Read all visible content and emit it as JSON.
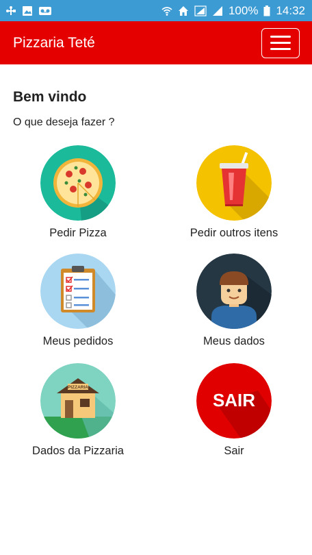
{
  "statusbar": {
    "battery": "100%",
    "time": "14:32",
    "icons": [
      "usb-icon",
      "image-icon",
      "voicemail-icon",
      "wifi-icon",
      "home-icon",
      "signal-icon",
      "signal-icon",
      "battery-icon"
    ]
  },
  "appbar": {
    "title": "Pizzaria Teté",
    "menu_icon": "hamburger-menu-icon"
  },
  "main": {
    "welcome": "Bem vindo",
    "question": "O que deseja fazer ?",
    "tiles": [
      {
        "label": "Pedir Pizza",
        "icon": "pizza-icon",
        "color": "#1aba9a"
      },
      {
        "label": "Pedir outros itens",
        "icon": "drink-cup-icon",
        "color": "#f5c200"
      },
      {
        "label": "Meus pedidos",
        "icon": "clipboard-checklist-icon",
        "color": "#a9d7f2"
      },
      {
        "label": "Meus dados",
        "icon": "user-avatar-icon",
        "color": "#263744"
      },
      {
        "label": "Dados da Pizzaria",
        "icon": "pizzaria-house-icon",
        "color": "#7fd3c1",
        "sign_text": "PIZZARIA"
      },
      {
        "label": "Sair",
        "icon": "exit-sair-icon",
        "color": "#e00000",
        "icon_text": "SAIR"
      }
    ]
  },
  "colors": {
    "statusbar": "#3d9bd3",
    "appbar": "#e50000"
  }
}
